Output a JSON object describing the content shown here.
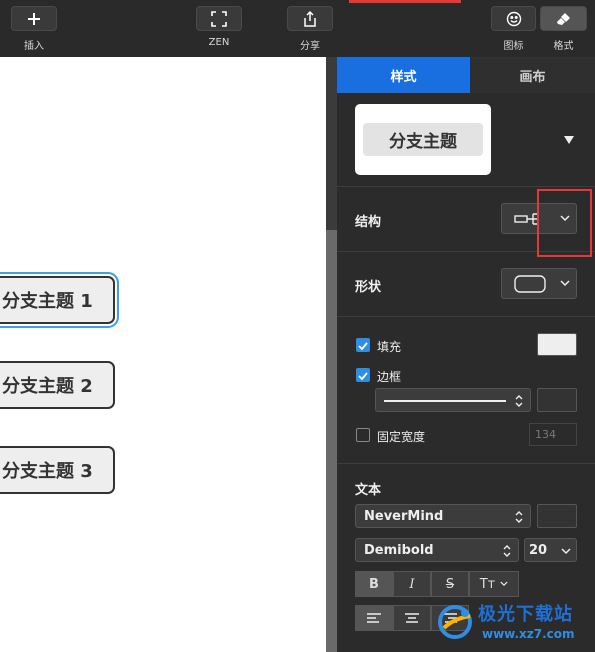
{
  "toolbar": {
    "insert_label": "插入",
    "zen_label": "ZEN",
    "share_label": "分享",
    "icons_label": "图标",
    "format_label": "格式"
  },
  "canvas": {
    "topics": [
      "分支主题 1",
      "分支主题 2",
      "分支主题 3"
    ]
  },
  "panel": {
    "tabs": [
      {
        "label": "样式",
        "active": true
      },
      {
        "label": "画布",
        "active": false
      }
    ],
    "preview_label": "分支主题",
    "structure_label": "结构",
    "shape_label": "形状",
    "fill_label": "填充",
    "border_label": "边框",
    "fixed_width_label": "固定宽度",
    "fixed_width_value": "134",
    "text_section_label": "文本",
    "font_family": "NeverMind",
    "font_weight": "Demibold",
    "font_size": "20",
    "bold_label": "B",
    "italic_label": "I",
    "strike_label": "S",
    "case_label": "Tт"
  },
  "watermark": {
    "text": "极光下载站",
    "url": "www.xz7.com"
  },
  "colors": {
    "accent": "#1a6fe0",
    "highlight_box": "#e53935",
    "selection_outline": "#3aa1e6"
  }
}
